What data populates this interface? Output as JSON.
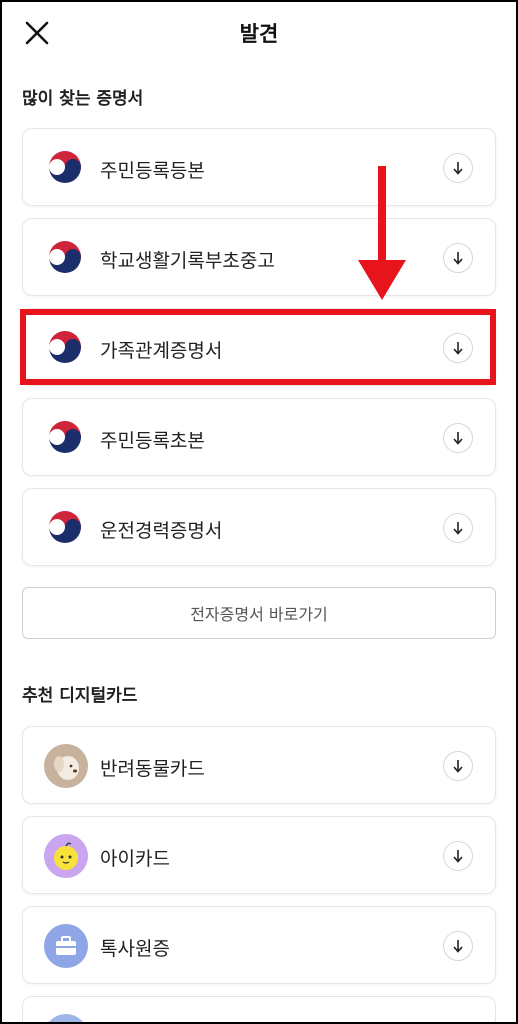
{
  "header": {
    "title": "발견",
    "close_icon": "close-icon"
  },
  "certificates": {
    "section_title": "많이 찾는 증명서",
    "items": [
      {
        "label": "주민등록등본",
        "icon": "government-emblem-icon"
      },
      {
        "label": "학교생활기록부초중고",
        "icon": "government-emblem-icon"
      },
      {
        "label": "가족관계증명서",
        "icon": "government-emblem-icon",
        "highlighted": true
      },
      {
        "label": "주민등록초본",
        "icon": "government-emblem-icon"
      },
      {
        "label": "운전경력증명서",
        "icon": "government-emblem-icon"
      }
    ],
    "link_label": "전자증명서 바로가기"
  },
  "digital_cards": {
    "section_title": "추천 디지털카드",
    "items": [
      {
        "label": "반려동물카드",
        "icon": "pet-dog-icon"
      },
      {
        "label": "아이카드",
        "icon": "child-face-icon"
      },
      {
        "label": "톡사원증",
        "icon": "briefcase-icon"
      }
    ]
  },
  "colors": {
    "highlight": "#e8141c",
    "emblem_red": "#d0243a",
    "emblem_blue": "#1b2d6b"
  }
}
